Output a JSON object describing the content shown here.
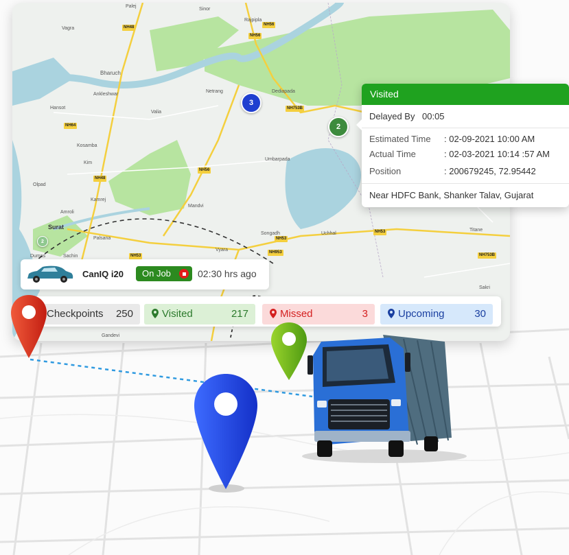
{
  "map": {
    "towns": [
      "Palej",
      "Sinor",
      "Rajpipla",
      "Vagra",
      "Bharuch",
      "Ankleshwar",
      "Netrang",
      "Dediapada",
      "Hansot",
      "Valia",
      "Kosamba",
      "Kim",
      "Umbarpada",
      "Olpad",
      "Kamrej",
      "Amroli",
      "Mandvi",
      "Surat",
      "Palsana",
      "Sachin",
      "Vyara",
      "Songadh",
      "Uchhal",
      "Titane",
      "Sakri",
      "Dumas",
      "Gandevi"
    ],
    "highways": [
      "NH48",
      "NH56",
      "NH56",
      "NH753B",
      "NH64",
      "NH48",
      "NH56",
      "NH53",
      "NH953",
      "NH53",
      "NH753B",
      "NH53"
    ],
    "clusters": {
      "blue": "3",
      "green": "2",
      "small": "2"
    },
    "colors": {
      "water": "#aad3df",
      "forest": "#b7e4a0",
      "land": "#eef1ee",
      "highway": "#f4cf3e"
    }
  },
  "popup": {
    "status": "Visited",
    "delayed_label": "Delayed By",
    "delayed_value": "00:05",
    "estimated_label": "Estimated Time",
    "estimated_value": ": 02-09-2021 10:00 AM",
    "actual_label": "Actual Time",
    "actual_value": ": 02-03-2021 10:14 :57 AM",
    "position_label": "Position",
    "position_value": ": 200679245, 72.95442",
    "address": "Near HDFC Bank, Shanker Talav, Gujarat",
    "header_color": "#1fa21f"
  },
  "vehicle": {
    "name": "CanIQ i20",
    "status": "On Job",
    "duration": "02:30 hrs ago",
    "car_color": "#2f7f9a",
    "status_color": "#2c8a1f"
  },
  "stats": [
    {
      "label": "Checkpoints",
      "count": "250",
      "icon": "checkpoint-icon",
      "bg": "#e9e9e9",
      "color": "#333"
    },
    {
      "label": "Visited",
      "count": "217",
      "icon": "location-pin-icon",
      "bg": "#dcf0d6",
      "color": "#2c7a2c"
    },
    {
      "label": "Missed",
      "count": "3",
      "icon": "location-pin-icon",
      "bg": "#fbdada",
      "color": "#d42020"
    },
    {
      "label": "Upcoming",
      "count": "30",
      "icon": "location-pin-icon",
      "bg": "#d6e8fb",
      "color": "#1a3fa0"
    }
  ],
  "illustration": {
    "pins": [
      "red-map-pin-icon",
      "blue-map-pin-icon",
      "green-map-pin-icon"
    ],
    "truck": "blue-truck-icon",
    "truck_color": "#2a6fd6"
  }
}
